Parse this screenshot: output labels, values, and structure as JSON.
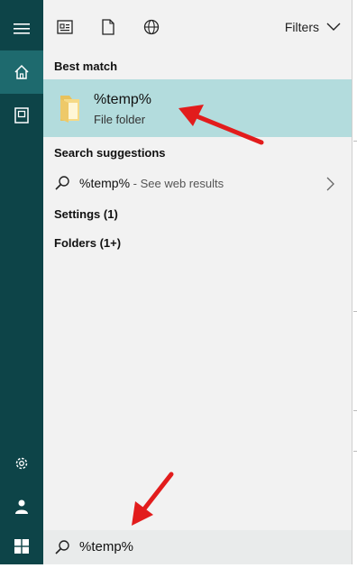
{
  "toolbar": {
    "filters_label": "Filters"
  },
  "best_match": {
    "heading": "Best match",
    "item": {
      "name": "%temp%",
      "type": "File folder"
    }
  },
  "suggestions": {
    "heading": "Search suggestions",
    "item": {
      "query": "%temp%",
      "suffix": " - See web results"
    }
  },
  "settings": {
    "label": "Settings (1)"
  },
  "folders": {
    "label": "Folders (1+)"
  },
  "search": {
    "value": "%temp%"
  },
  "colors": {
    "rail": "#0d4448",
    "rail_active": "#1e6a6e",
    "panel": "#f2f2f2",
    "highlight": "#b3dcdd",
    "arrow": "#e21c1c"
  },
  "icons": [
    "hamburger-icon",
    "home-icon",
    "document-frame-icon",
    "settings-gear-icon",
    "user-icon",
    "windows-start-icon",
    "news-card-icon",
    "file-icon",
    "globe-icon",
    "chevron-down-icon",
    "folder-icon",
    "search-icon",
    "chevron-right-icon"
  ]
}
